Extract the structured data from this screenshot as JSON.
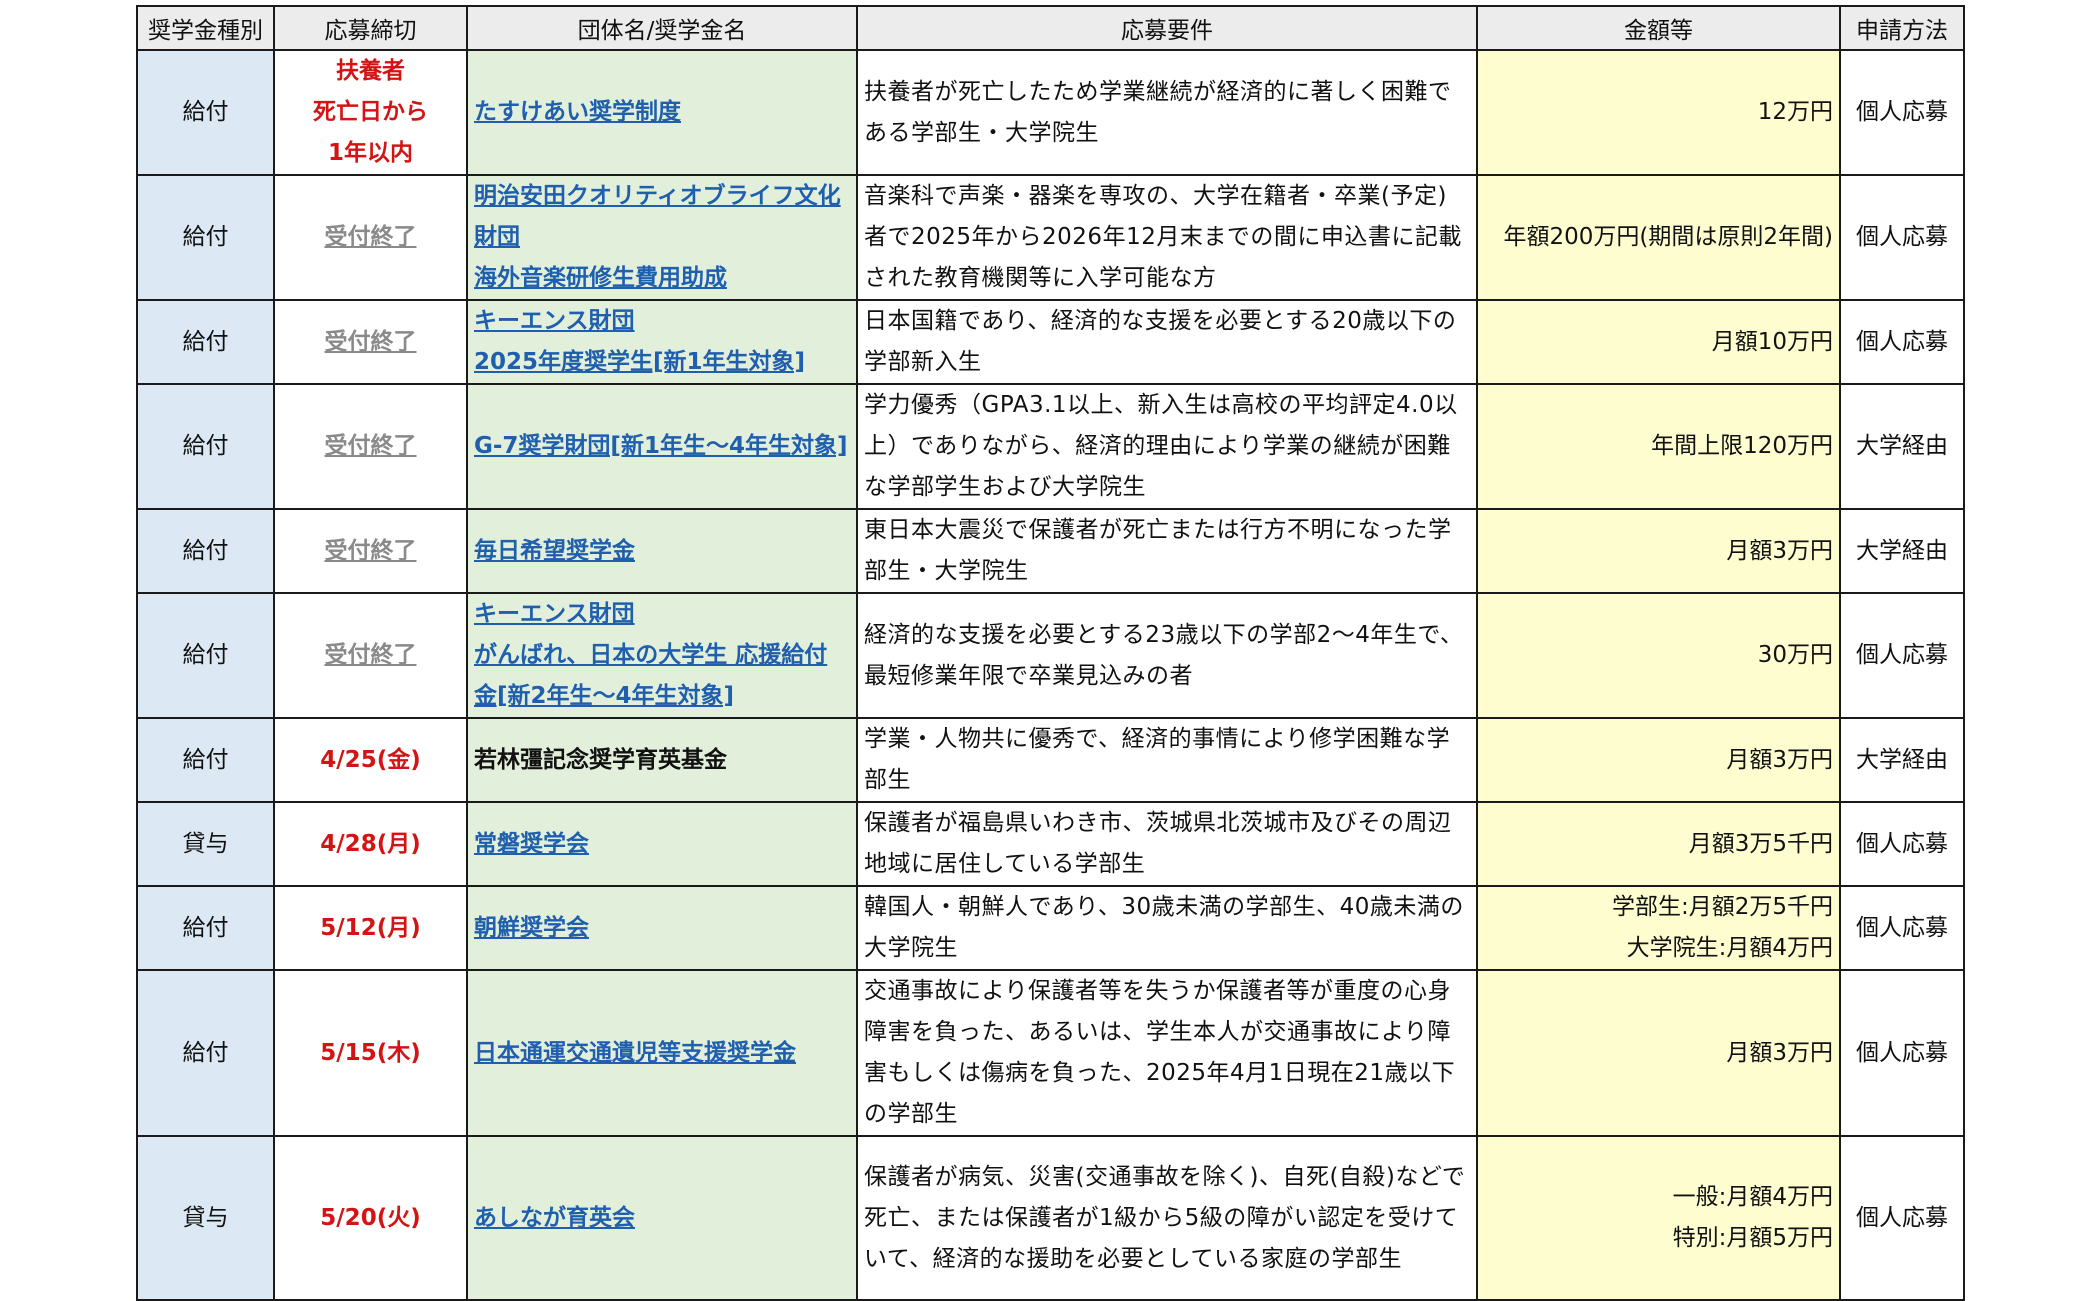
{
  "headers": {
    "type": "奨学金種別",
    "deadline": "応募締切",
    "org": "団体名/奨学金名",
    "req": "応募要件",
    "amount": "金額等",
    "method": "申請方法"
  },
  "rows": [
    {
      "type": "給付",
      "deadline": [
        "扶養者",
        "死亡日から",
        "1年以内"
      ],
      "deadline_status": "open",
      "org": [
        "たすけあい奨学制度"
      ],
      "org_link": true,
      "req": "扶養者が死亡したため学業継続が経済的に著しく困難である学部生・大学院生",
      "amount": [
        "12万円"
      ],
      "method": "個人応募"
    },
    {
      "type": "給付",
      "deadline": [
        "受付終了"
      ],
      "deadline_status": "closed",
      "org": [
        "明治安田クオリティオブライフ文化財団",
        "海外音楽研修生費用助成"
      ],
      "org_link": true,
      "req": "音楽科で声楽・器楽を専攻の、大学在籍者・卒業(予定)者で2025年から2026年12月末までの間に申込書に記載された教育機関等に入学可能な方",
      "amount": [
        "年額200万円(期間は原則2年間)"
      ],
      "method": "個人応募"
    },
    {
      "type": "給付",
      "deadline": [
        "受付終了"
      ],
      "deadline_status": "closed",
      "org": [
        "キーエンス財団",
        "2025年度奨学生[新1年生対象]"
      ],
      "org_link": true,
      "req": "日本国籍であり、経済的な支援を必要とする20歳以下の学部新入生",
      "amount": [
        "月額10万円"
      ],
      "method": "個人応募"
    },
    {
      "type": "給付",
      "deadline": [
        "受付終了"
      ],
      "deadline_status": "closed",
      "org": [
        "G-7奨学財団[新1年生～4年生対象]"
      ],
      "org_link": true,
      "req": "学力優秀（GPA3.1以上、新入生は高校の平均評定4.0以上）でありながら、経済的理由により学業の継続が困難な学部学生および大学院生",
      "amount": [
        "年間上限120万円"
      ],
      "method": "大学経由"
    },
    {
      "type": "給付",
      "deadline": [
        "受付終了"
      ],
      "deadline_status": "closed",
      "org": [
        "毎日希望奨学金"
      ],
      "org_link": true,
      "req": "東日本大震災で保護者が死亡または行方不明になった学部生・大学院生",
      "amount": [
        "月額3万円"
      ],
      "method": "大学経由"
    },
    {
      "type": "給付",
      "deadline": [
        "受付終了"
      ],
      "deadline_status": "closed",
      "org": [
        "キーエンス財団",
        "がんばれ、日本の大学生 応援給付金[新2年生～4年生対象]"
      ],
      "org_link": true,
      "req": "経済的な支援を必要とする23歳以下の学部2～4年生で、最短修業年限で卒業見込みの者",
      "amount": [
        "30万円"
      ],
      "method": "個人応募"
    },
    {
      "type": "給付",
      "deadline": [
        "4/25(金)"
      ],
      "deadline_status": "open",
      "org": [
        "若林彊記念奨学育英基金"
      ],
      "org_link": false,
      "req": "学業・人物共に優秀で、経済的事情により修学困難な学部生",
      "amount": [
        "月額3万円"
      ],
      "method": "大学経由"
    },
    {
      "type": "貸与",
      "deadline": [
        "4/28(月)"
      ],
      "deadline_status": "open",
      "org": [
        "常磐奨学会"
      ],
      "org_link": true,
      "req": "保護者が福島県いわき市、茨城県北茨城市及びその周辺地域に居住している学部生",
      "amount": [
        "月額3万5千円"
      ],
      "method": "個人応募"
    },
    {
      "type": "給付",
      "deadline": [
        "5/12(月)"
      ],
      "deadline_status": "open",
      "org": [
        "朝鮮奨学会"
      ],
      "org_link": true,
      "req": "韓国人・朝鮮人であり、30歳未満の学部生、40歳未満の大学院生",
      "amount": [
        "学部生:月額2万5千円",
        "大学院生:月額4万円"
      ],
      "method": "個人応募"
    },
    {
      "type": "給付",
      "deadline": [
        "5/15(木)"
      ],
      "deadline_status": "open",
      "org": [
        "日本通運交通遺児等支援奨学金"
      ],
      "org_link": true,
      "req": "交通事故により保護者等を失うか保護者等が重度の心身障害を負った、あるいは、学生本人が交通事故により障害もしくは傷病を負った、2025年4月1日現在21歳以下の学部生",
      "amount": [
        "月額3万円"
      ],
      "method": "個人応募"
    },
    {
      "type": "貸与",
      "deadline": [
        "5/20(火)"
      ],
      "deadline_status": "open",
      "org": [
        "あしなが育英会"
      ],
      "org_link": true,
      "req": "保護者が病気、災害(交通事故を除く)、自死(自殺)などで死亡、または保護者が1級から5級の障がい認定を受けていて、経済的な援助を必要としている家庭の学部生",
      "amount": [
        "一般:月額4万円",
        "特別:月額5万円"
      ],
      "method": "個人応募"
    }
  ]
}
